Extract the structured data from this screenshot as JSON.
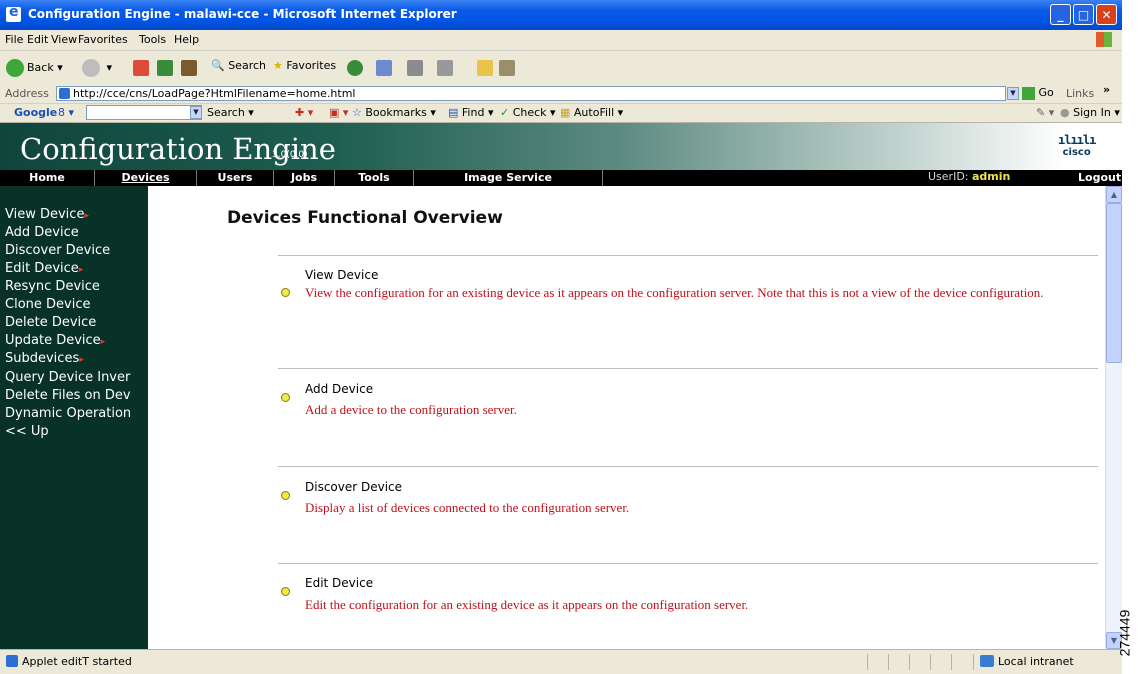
{
  "window": {
    "title": "Configuration Engine - malawi-cce - Microsoft Internet Explorer",
    "controls": {
      "minimize": "_",
      "maximize": "□",
      "close": "✕"
    }
  },
  "menu": [
    "File",
    "Edit",
    "View",
    "Favorites",
    "Tools",
    "Help"
  ],
  "toolbar": {
    "back": "Back",
    "search": "Search",
    "favorites": "Favorites"
  },
  "address": {
    "label": "Address",
    "url": "http://cce/cns/LoadPage?HtmlFilename=home.html",
    "go": "Go",
    "links": "Links",
    "links_chevron": "»"
  },
  "googlebar": {
    "logo": "Google",
    "search": "Search",
    "bookmarks": "Bookmarks",
    "find": "Find",
    "check": "Check",
    "autofill": "AutoFill",
    "signin": "Sign In"
  },
  "app": {
    "title": "Configuration Engine",
    "version": "3.0(0.0)",
    "logo": "cisco"
  },
  "nav": {
    "items": [
      "Home",
      "Devices",
      "Users",
      "Jobs",
      "Tools",
      "Image Service"
    ],
    "active": "Devices",
    "userid_label": "UserID:",
    "userid": "admin",
    "logout": "Logout"
  },
  "sidebar": {
    "items": [
      {
        "label": "View Device",
        "arrow": "▸"
      },
      {
        "label": "Add Device",
        "arrow": ""
      },
      {
        "label": "Discover Device",
        "arrow": ""
      },
      {
        "label": "Edit Device",
        "arrow": "▸"
      },
      {
        "label": "Resync Device",
        "arrow": ""
      },
      {
        "label": "Clone Device",
        "arrow": ""
      },
      {
        "label": "Delete Device",
        "arrow": ""
      },
      {
        "label": "Update Device",
        "arrow": "▸"
      },
      {
        "label": "Subdevices",
        "arrow": "▸"
      },
      {
        "label": "Query Device Inver",
        "arrow": ""
      },
      {
        "label": "Delete Files on Dev",
        "arrow": ""
      },
      {
        "label": "Dynamic Operation",
        "arrow": ""
      },
      {
        "label": "<< Up",
        "arrow": ""
      }
    ]
  },
  "content": {
    "heading": "Devices Functional Overview",
    "sections": [
      {
        "title": "View Device",
        "desc": "View the configuration for an existing device as it appears on the configuration server. Note that this is not a view of the device configuration."
      },
      {
        "title": "Add Device",
        "desc": "Add a device to the configuration server."
      },
      {
        "title": "Discover Device",
        "desc": "Display a list of devices connected to the configuration server."
      },
      {
        "title": "Edit Device",
        "desc": "Edit the configuration for an existing device as it appears on the configuration server."
      }
    ]
  },
  "status": {
    "text": "Applet editT started",
    "zone": "Local intranet"
  },
  "figure_number": "274449",
  "colors": {
    "sidebar_bg": "#083127",
    "desc_text": "#C0101A",
    "userid": "#F1E34B"
  }
}
